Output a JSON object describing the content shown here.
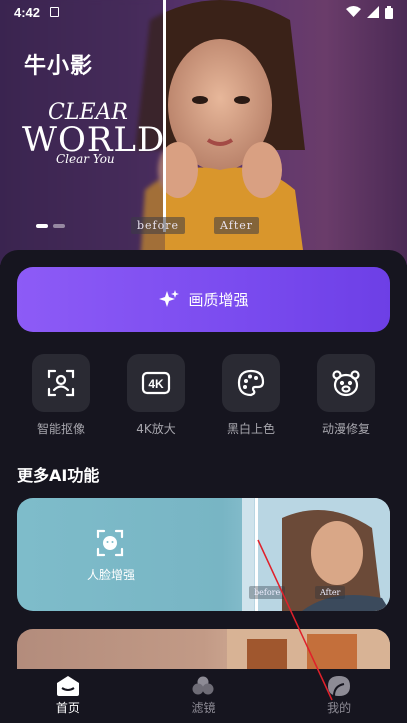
{
  "status_bar": {
    "time": "4:42"
  },
  "hero": {
    "brand": "牛小影",
    "slogan_line1": "CLEAR",
    "slogan_line2": "WORLD",
    "slogan_line3": "Clear You",
    "before_tag": "before",
    "after_tag": "After",
    "carousel_pages": 2,
    "carousel_active": 0
  },
  "enhance_button": {
    "label": "画质增强",
    "icon": "sparkle-icon"
  },
  "tools": [
    {
      "label": "智能抠像",
      "icon": "portrait-cutout-icon"
    },
    {
      "label": "4K放大",
      "icon": "4k-icon"
    },
    {
      "label": "黑白上色",
      "icon": "palette-icon"
    },
    {
      "label": "动漫修复",
      "icon": "bear-face-icon"
    }
  ],
  "more_ai": {
    "title": "更多AI功能",
    "cards": [
      {
        "label": "人脸增强",
        "icon": "face-enhance-icon",
        "before_tag": "before",
        "after_tag": "After"
      }
    ]
  },
  "bottom_nav": [
    {
      "label": "首页",
      "icon": "home-icon",
      "active": true
    },
    {
      "label": "滤镜",
      "icon": "filter-icon",
      "active": false
    },
    {
      "label": "我的",
      "icon": "profile-icon",
      "active": false
    }
  ],
  "colors": {
    "background": "#16151f",
    "accent": "#7a4bef",
    "tool_tile": "#2a2a33",
    "muted_text": "#a7a6ad",
    "annotation_line": "#e0202a"
  }
}
